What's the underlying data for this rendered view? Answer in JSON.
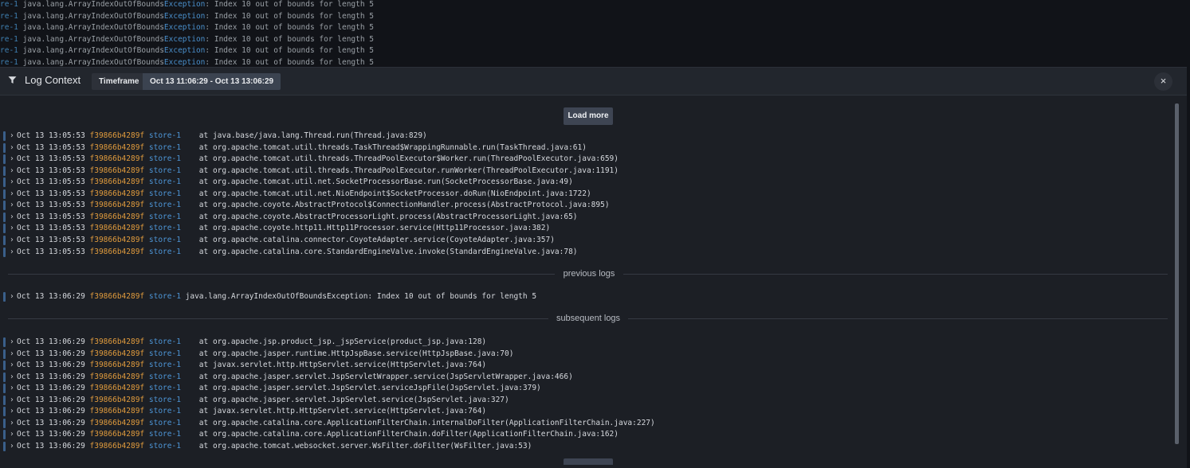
{
  "background_log": {
    "prefix": "re-1",
    "exception_class": "java.lang.ArrayIndexOutOfBounds",
    "exception_word": "Exception",
    "message": ": Index 10 out of bounds for length 5",
    "count": 6
  },
  "panel": {
    "title": "Log Context",
    "timeframe_label": "Timeframe",
    "timeframe_value": "Oct 13 11:06:29 - Oct 13 13:06:29",
    "close_label": "×",
    "load_more_label": "Load more"
  },
  "before_rows": [
    {
      "ts": "Oct 13 13:05:53",
      "hash": "f39866b4289f",
      "svc": "store-1",
      "msg": "   at java.base/java.lang.Thread.run(Thread.java:829)"
    },
    {
      "ts": "Oct 13 13:05:53",
      "hash": "f39866b4289f",
      "svc": "store-1",
      "msg": "   at org.apache.tomcat.util.threads.TaskThread$WrappingRunnable.run(TaskThread.java:61)"
    },
    {
      "ts": "Oct 13 13:05:53",
      "hash": "f39866b4289f",
      "svc": "store-1",
      "msg": "   at org.apache.tomcat.util.threads.ThreadPoolExecutor$Worker.run(ThreadPoolExecutor.java:659)"
    },
    {
      "ts": "Oct 13 13:05:53",
      "hash": "f39866b4289f",
      "svc": "store-1",
      "msg": "   at org.apache.tomcat.util.threads.ThreadPoolExecutor.runWorker(ThreadPoolExecutor.java:1191)"
    },
    {
      "ts": "Oct 13 13:05:53",
      "hash": "f39866b4289f",
      "svc": "store-1",
      "msg": "   at org.apache.tomcat.util.net.SocketProcessorBase.run(SocketProcessorBase.java:49)"
    },
    {
      "ts": "Oct 13 13:05:53",
      "hash": "f39866b4289f",
      "svc": "store-1",
      "msg": "   at org.apache.tomcat.util.net.NioEndpoint$SocketProcessor.doRun(NioEndpoint.java:1722)"
    },
    {
      "ts": "Oct 13 13:05:53",
      "hash": "f39866b4289f",
      "svc": "store-1",
      "msg": "   at org.apache.coyote.AbstractProtocol$ConnectionHandler.process(AbstractProtocol.java:895)"
    },
    {
      "ts": "Oct 13 13:05:53",
      "hash": "f39866b4289f",
      "svc": "store-1",
      "msg": "   at org.apache.coyote.AbstractProcessorLight.process(AbstractProcessorLight.java:65)"
    },
    {
      "ts": "Oct 13 13:05:53",
      "hash": "f39866b4289f",
      "svc": "store-1",
      "msg": "   at org.apache.coyote.http11.Http11Processor.service(Http11Processor.java:382)"
    },
    {
      "ts": "Oct 13 13:05:53",
      "hash": "f39866b4289f",
      "svc": "store-1",
      "msg": "   at org.apache.catalina.connector.CoyoteAdapter.service(CoyoteAdapter.java:357)"
    },
    {
      "ts": "Oct 13 13:05:53",
      "hash": "f39866b4289f",
      "svc": "store-1",
      "msg": "   at org.apache.catalina.core.StandardEngineValve.invoke(StandardEngineValve.java:78)"
    }
  ],
  "previous_label": "previous logs",
  "current_row": {
    "ts": "Oct 13 13:06:29",
    "hash": "f39866b4289f",
    "svc": "store-1",
    "msg": "java.lang.ArrayIndexOutOfBoundsException: Index 10 out of bounds for length 5"
  },
  "subsequent_label": "subsequent logs",
  "after_rows": [
    {
      "ts": "Oct 13 13:06:29",
      "hash": "f39866b4289f",
      "svc": "store-1",
      "msg": "   at org.apache.jsp.product_jsp._jspService(product_jsp.java:128)"
    },
    {
      "ts": "Oct 13 13:06:29",
      "hash": "f39866b4289f",
      "svc": "store-1",
      "msg": "   at org.apache.jasper.runtime.HttpJspBase.service(HttpJspBase.java:70)"
    },
    {
      "ts": "Oct 13 13:06:29",
      "hash": "f39866b4289f",
      "svc": "store-1",
      "msg": "   at javax.servlet.http.HttpServlet.service(HttpServlet.java:764)"
    },
    {
      "ts": "Oct 13 13:06:29",
      "hash": "f39866b4289f",
      "svc": "store-1",
      "msg": "   at org.apache.jasper.servlet.JspServletWrapper.service(JspServletWrapper.java:466)"
    },
    {
      "ts": "Oct 13 13:06:29",
      "hash": "f39866b4289f",
      "svc": "store-1",
      "msg": "   at org.apache.jasper.servlet.JspServlet.serviceJspFile(JspServlet.java:379)"
    },
    {
      "ts": "Oct 13 13:06:29",
      "hash": "f39866b4289f",
      "svc": "store-1",
      "msg": "   at org.apache.jasper.servlet.JspServlet.service(JspServlet.java:327)"
    },
    {
      "ts": "Oct 13 13:06:29",
      "hash": "f39866b4289f",
      "svc": "store-1",
      "msg": "   at javax.servlet.http.HttpServlet.service(HttpServlet.java:764)"
    },
    {
      "ts": "Oct 13 13:06:29",
      "hash": "f39866b4289f",
      "svc": "store-1",
      "msg": "   at org.apache.catalina.core.ApplicationFilterChain.internalDoFilter(ApplicationFilterChain.java:227)"
    },
    {
      "ts": "Oct 13 13:06:29",
      "hash": "f39866b4289f",
      "svc": "store-1",
      "msg": "   at org.apache.catalina.core.ApplicationFilterChain.doFilter(ApplicationFilterChain.java:162)"
    },
    {
      "ts": "Oct 13 13:06:29",
      "hash": "f39866b4289f",
      "svc": "store-1",
      "msg": "   at org.apache.tomcat.websocket.server.WsFilter.doFilter(WsFilter.java:53)"
    }
  ],
  "colors": {
    "hash": "#e09b3d",
    "service": "#4d95d6",
    "accent_bar": "#3a5f8a"
  },
  "icons": {
    "filter": "filter-icon",
    "chevron": "chevron-right-icon",
    "close": "close-icon"
  }
}
